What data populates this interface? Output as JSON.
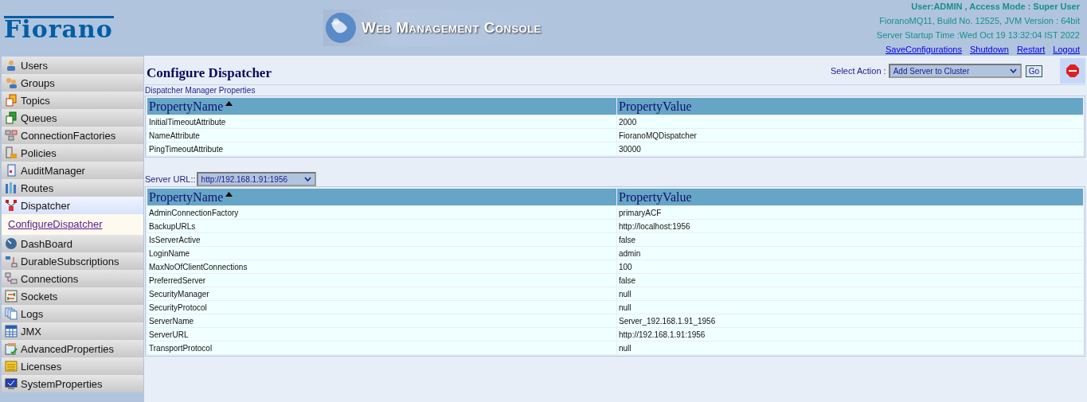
{
  "header": {
    "logo": "Fiorano",
    "console_title": "Web Management Console",
    "user_info": "User:ADMIN , Access Mode : Super User",
    "build_info": "FioranoMQ11, Build No. 12525, JVM Version : 64bit",
    "startup_info": "Server Startup Time :Wed Oct 19 13:32:04 IST 2022",
    "links": [
      "SaveConfigurations",
      "Shutdown",
      "Restart",
      "Logout"
    ]
  },
  "sidebar": {
    "items": [
      {
        "label": "Users",
        "selected": false
      },
      {
        "label": "Groups",
        "selected": false
      },
      {
        "label": "Topics",
        "selected": false
      },
      {
        "label": "Queues",
        "selected": false
      },
      {
        "label": "ConnectionFactories",
        "selected": false
      },
      {
        "label": "Policies",
        "selected": false
      },
      {
        "label": "AuditManager",
        "selected": false
      },
      {
        "label": "Routes",
        "selected": false
      },
      {
        "label": "Dispatcher",
        "selected": true,
        "children": [
          {
            "label": "ConfigureDispatcher"
          }
        ]
      },
      {
        "label": "DashBoard",
        "selected": false
      },
      {
        "label": "DurableSubscriptions",
        "selected": false
      },
      {
        "label": "Connections",
        "selected": false
      },
      {
        "label": "Sockets",
        "selected": false
      },
      {
        "label": "Logs",
        "selected": false
      },
      {
        "label": "JMX",
        "selected": false
      },
      {
        "label": "AdvancedProperties",
        "selected": false
      },
      {
        "label": "Licenses",
        "selected": false
      },
      {
        "label": "SystemProperties",
        "selected": false
      }
    ]
  },
  "main": {
    "title": "Configure Dispatcher",
    "action_label": "Select Action :",
    "action_value": "Add Server to Cluster",
    "go_button": "Go",
    "manager_section": {
      "caption": "Dispatcher Manager Properties",
      "columns": [
        "PropertyName",
        "PropertyValue"
      ],
      "rows": [
        [
          "InitialTimeoutAttribute",
          "2000"
        ],
        [
          "NameAttribute",
          "FioranoMQDispatcher"
        ],
        [
          "PingTimeoutAttribute",
          "30000"
        ]
      ]
    },
    "server_url_label": "Server URL::",
    "server_url_value": "http://192.168.1.91:1956",
    "server_section": {
      "columns": [
        "PropertyName",
        "PropertyValue"
      ],
      "rows": [
        [
          "AdminConnectionFactory",
          "primaryACF"
        ],
        [
          "BackupURLs",
          "http://localhost:1956"
        ],
        [
          "IsServerActive",
          "false"
        ],
        [
          "LoginName",
          "admin"
        ],
        [
          "MaxNoOfClientConnections",
          "100"
        ],
        [
          "PreferredServer",
          "false"
        ],
        [
          "SecurityManager",
          "null"
        ],
        [
          "SecurityProtocol",
          "null"
        ],
        [
          "ServerName",
          "Server_192.168.1.91_1956"
        ],
        [
          "ServerURL",
          "http://192.168.1.91:1956"
        ],
        [
          "TransportProtocol",
          "null"
        ]
      ]
    }
  }
}
